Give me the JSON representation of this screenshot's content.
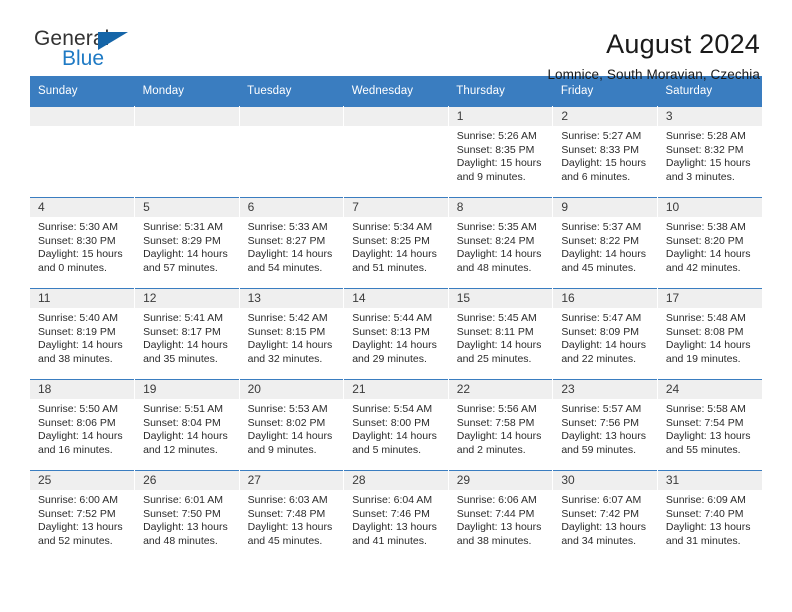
{
  "logo": {
    "primary_text": "General",
    "secondary_text": "Blue",
    "triangle_color": "#1565a8",
    "blue_color": "#1f7ac4"
  },
  "header": {
    "title": "August 2024",
    "subtitle": "Lomnice, South Moravian, Czechia"
  },
  "theme": {
    "header_row_bg": "#3a7dc0",
    "daynum_bg": "#efefef",
    "cell_bg": "#ffffff",
    "text_color": "#2b2b2b"
  },
  "weekdays": [
    "Sunday",
    "Monday",
    "Tuesday",
    "Wednesday",
    "Thursday",
    "Friday",
    "Saturday"
  ],
  "weeks": [
    [
      {
        "day": "",
        "lines": []
      },
      {
        "day": "",
        "lines": []
      },
      {
        "day": "",
        "lines": []
      },
      {
        "day": "",
        "lines": []
      },
      {
        "day": "1",
        "lines": [
          "Sunrise: 5:26 AM",
          "Sunset: 8:35 PM",
          "Daylight: 15 hours",
          "and 9 minutes."
        ]
      },
      {
        "day": "2",
        "lines": [
          "Sunrise: 5:27 AM",
          "Sunset: 8:33 PM",
          "Daylight: 15 hours",
          "and 6 minutes."
        ]
      },
      {
        "day": "3",
        "lines": [
          "Sunrise: 5:28 AM",
          "Sunset: 8:32 PM",
          "Daylight: 15 hours",
          "and 3 minutes."
        ]
      }
    ],
    [
      {
        "day": "4",
        "lines": [
          "Sunrise: 5:30 AM",
          "Sunset: 8:30 PM",
          "Daylight: 15 hours",
          "and 0 minutes."
        ]
      },
      {
        "day": "5",
        "lines": [
          "Sunrise: 5:31 AM",
          "Sunset: 8:29 PM",
          "Daylight: 14 hours",
          "and 57 minutes."
        ]
      },
      {
        "day": "6",
        "lines": [
          "Sunrise: 5:33 AM",
          "Sunset: 8:27 PM",
          "Daylight: 14 hours",
          "and 54 minutes."
        ]
      },
      {
        "day": "7",
        "lines": [
          "Sunrise: 5:34 AM",
          "Sunset: 8:25 PM",
          "Daylight: 14 hours",
          "and 51 minutes."
        ]
      },
      {
        "day": "8",
        "lines": [
          "Sunrise: 5:35 AM",
          "Sunset: 8:24 PM",
          "Daylight: 14 hours",
          "and 48 minutes."
        ]
      },
      {
        "day": "9",
        "lines": [
          "Sunrise: 5:37 AM",
          "Sunset: 8:22 PM",
          "Daylight: 14 hours",
          "and 45 minutes."
        ]
      },
      {
        "day": "10",
        "lines": [
          "Sunrise: 5:38 AM",
          "Sunset: 8:20 PM",
          "Daylight: 14 hours",
          "and 42 minutes."
        ]
      }
    ],
    [
      {
        "day": "11",
        "lines": [
          "Sunrise: 5:40 AM",
          "Sunset: 8:19 PM",
          "Daylight: 14 hours",
          "and 38 minutes."
        ]
      },
      {
        "day": "12",
        "lines": [
          "Sunrise: 5:41 AM",
          "Sunset: 8:17 PM",
          "Daylight: 14 hours",
          "and 35 minutes."
        ]
      },
      {
        "day": "13",
        "lines": [
          "Sunrise: 5:42 AM",
          "Sunset: 8:15 PM",
          "Daylight: 14 hours",
          "and 32 minutes."
        ]
      },
      {
        "day": "14",
        "lines": [
          "Sunrise: 5:44 AM",
          "Sunset: 8:13 PM",
          "Daylight: 14 hours",
          "and 29 minutes."
        ]
      },
      {
        "day": "15",
        "lines": [
          "Sunrise: 5:45 AM",
          "Sunset: 8:11 PM",
          "Daylight: 14 hours",
          "and 25 minutes."
        ]
      },
      {
        "day": "16",
        "lines": [
          "Sunrise: 5:47 AM",
          "Sunset: 8:09 PM",
          "Daylight: 14 hours",
          "and 22 minutes."
        ]
      },
      {
        "day": "17",
        "lines": [
          "Sunrise: 5:48 AM",
          "Sunset: 8:08 PM",
          "Daylight: 14 hours",
          "and 19 minutes."
        ]
      }
    ],
    [
      {
        "day": "18",
        "lines": [
          "Sunrise: 5:50 AM",
          "Sunset: 8:06 PM",
          "Daylight: 14 hours",
          "and 16 minutes."
        ]
      },
      {
        "day": "19",
        "lines": [
          "Sunrise: 5:51 AM",
          "Sunset: 8:04 PM",
          "Daylight: 14 hours",
          "and 12 minutes."
        ]
      },
      {
        "day": "20",
        "lines": [
          "Sunrise: 5:53 AM",
          "Sunset: 8:02 PM",
          "Daylight: 14 hours",
          "and 9 minutes."
        ]
      },
      {
        "day": "21",
        "lines": [
          "Sunrise: 5:54 AM",
          "Sunset: 8:00 PM",
          "Daylight: 14 hours",
          "and 5 minutes."
        ]
      },
      {
        "day": "22",
        "lines": [
          "Sunrise: 5:56 AM",
          "Sunset: 7:58 PM",
          "Daylight: 14 hours",
          "and 2 minutes."
        ]
      },
      {
        "day": "23",
        "lines": [
          "Sunrise: 5:57 AM",
          "Sunset: 7:56 PM",
          "Daylight: 13 hours",
          "and 59 minutes."
        ]
      },
      {
        "day": "24",
        "lines": [
          "Sunrise: 5:58 AM",
          "Sunset: 7:54 PM",
          "Daylight: 13 hours",
          "and 55 minutes."
        ]
      }
    ],
    [
      {
        "day": "25",
        "lines": [
          "Sunrise: 6:00 AM",
          "Sunset: 7:52 PM",
          "Daylight: 13 hours",
          "and 52 minutes."
        ]
      },
      {
        "day": "26",
        "lines": [
          "Sunrise: 6:01 AM",
          "Sunset: 7:50 PM",
          "Daylight: 13 hours",
          "and 48 minutes."
        ]
      },
      {
        "day": "27",
        "lines": [
          "Sunrise: 6:03 AM",
          "Sunset: 7:48 PM",
          "Daylight: 13 hours",
          "and 45 minutes."
        ]
      },
      {
        "day": "28",
        "lines": [
          "Sunrise: 6:04 AM",
          "Sunset: 7:46 PM",
          "Daylight: 13 hours",
          "and 41 minutes."
        ]
      },
      {
        "day": "29",
        "lines": [
          "Sunrise: 6:06 AM",
          "Sunset: 7:44 PM",
          "Daylight: 13 hours",
          "and 38 minutes."
        ]
      },
      {
        "day": "30",
        "lines": [
          "Sunrise: 6:07 AM",
          "Sunset: 7:42 PM",
          "Daylight: 13 hours",
          "and 34 minutes."
        ]
      },
      {
        "day": "31",
        "lines": [
          "Sunrise: 6:09 AM",
          "Sunset: 7:40 PM",
          "Daylight: 13 hours",
          "and 31 minutes."
        ]
      }
    ]
  ]
}
